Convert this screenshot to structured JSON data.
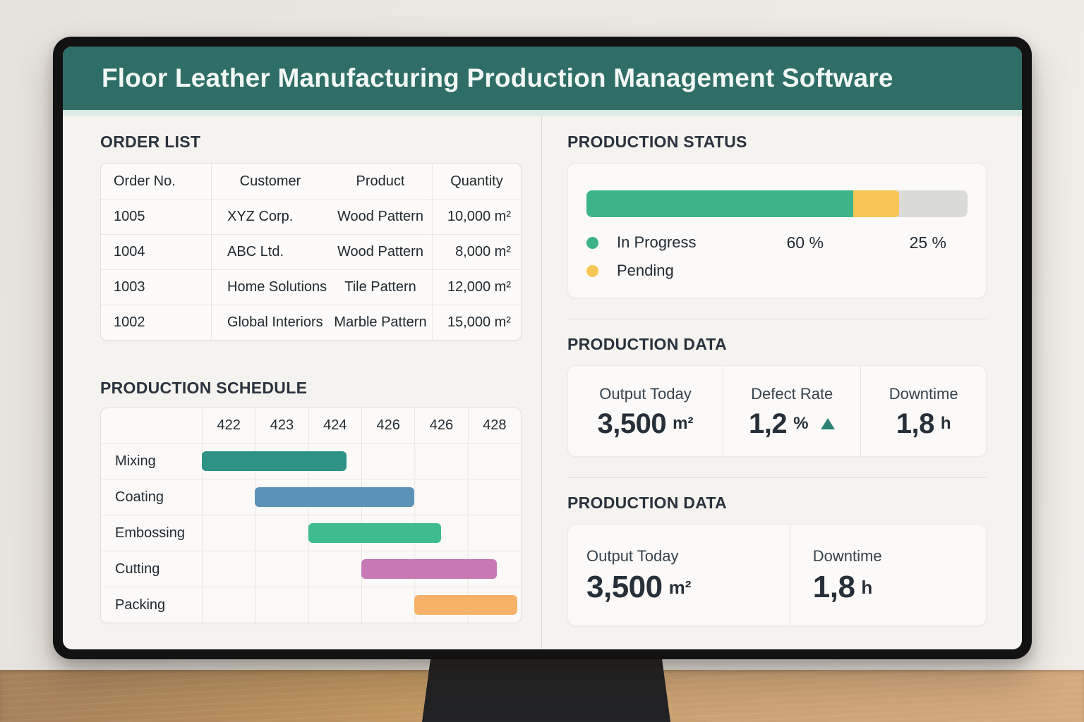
{
  "window": {
    "title": "Floor Leather Manufacturing Production Management Software"
  },
  "colors": {
    "header_teal": "#2e6e66",
    "screen_bg": "#f5f3ef",
    "accent_green": "#3cb389",
    "accent_yellow": "#f8c654",
    "track_gray": "#dadad7",
    "trend_teal": "#2c8276",
    "desk_wood_left": "#a6815b",
    "desk_wood_right": "#d5aa7f"
  },
  "order_list": {
    "heading": "ORDER LIST",
    "columns": [
      "Order No.",
      "Customer",
      "Product",
      "Quantity"
    ],
    "rows": [
      {
        "order_no": "1005",
        "customer": "XYZ Corp.",
        "product": "Wood Pattern",
        "quantity": "10,000 m²"
      },
      {
        "order_no": "1004",
        "customer": "ABC Ltd.",
        "product": "Wood Pattern",
        "quantity": "8,000 m²"
      },
      {
        "order_no": "1003",
        "customer": "Home Solutions",
        "product": "Tile Pattern",
        "quantity": "12,000 m²"
      },
      {
        "order_no": "1002",
        "customer": "Global Interiors",
        "product": "Marble Pattern",
        "quantity": "15,000 m²"
      }
    ]
  },
  "production_schedule": {
    "heading": "PRODUCTION SCHEDULE"
  },
  "production_status": {
    "heading": "PRODUCTION STATUS",
    "value_labels": [
      "60 %",
      "25 %"
    ]
  },
  "production_data_1": {
    "heading": "PRODUCTION DATA",
    "stats": [
      {
        "label": "Output Today",
        "value": "3,500",
        "unit": "m²"
      },
      {
        "label": "Defect Rate",
        "value": "1,2",
        "unit": "%",
        "trend": "up"
      },
      {
        "label": "Downtime",
        "value": "1,8",
        "unit": "h"
      }
    ]
  },
  "production_data_2": {
    "heading": "PRODUCTION DATA",
    "stats": [
      {
        "label": "Output Today",
        "value": "3,500",
        "unit": "m²"
      },
      {
        "label": "Downtime",
        "value": "1,8",
        "unit": "h"
      }
    ]
  },
  "chart_data": [
    {
      "type": "gantt",
      "title": "PRODUCTION SCHEDULE",
      "columns": [
        "422",
        "423",
        "424",
        "426",
        "426",
        "428"
      ],
      "tasks": [
        {
          "name": "Mixing",
          "start": 0,
          "end": 2.72,
          "color": "#2f9287"
        },
        {
          "name": "Coating",
          "start": 1,
          "end": 4.0,
          "color": "#5b93b8"
        },
        {
          "name": "Embossing",
          "start": 2,
          "end": 4.5,
          "color": "#3ebc8e"
        },
        {
          "name": "Cutting",
          "start": 3,
          "end": 5.55,
          "color": "#c77ab5"
        },
        {
          "name": "Packing",
          "start": 4,
          "end": 5.93,
          "color": "#f6b269"
        }
      ]
    },
    {
      "type": "stacked-bar",
      "title": "PRODUCTION STATUS",
      "track_color": "#dadad7",
      "segments": [
        {
          "label": "In Progress",
          "value_label": "60 %",
          "percent_width": 70,
          "color": "#3cb389"
        },
        {
          "label": "Pending",
          "value_label": "25 %",
          "percent_width": 12,
          "color": "#f8c654"
        }
      ]
    }
  ]
}
